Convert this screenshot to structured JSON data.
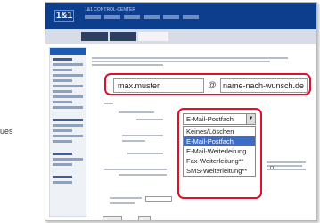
{
  "cut_text": "ues",
  "header": {
    "logo": "1&1",
    "title": "1&1 CONTROL-CENTER"
  },
  "nav": {
    "tabs": [
      "",
      "",
      ""
    ],
    "active_index": 2
  },
  "email": {
    "local_part": "max.muster",
    "at": "@",
    "domain": "name-nach-wunsch.de"
  },
  "dropdown": {
    "selected": "E-Mail-Postfach",
    "options": [
      "Keines/Löschen",
      "E-Mail-Postfach",
      "E-Mail-Weiterleitung",
      "Fax-Weiterleitung**",
      "SMS-Weiterleitung**"
    ],
    "highlighted_index": 1,
    "arrow": "▼"
  },
  "colors": {
    "brand_blue": "#0d3e8e",
    "highlight_red": "#e0102b",
    "selection_blue": "#3d6bc8"
  }
}
